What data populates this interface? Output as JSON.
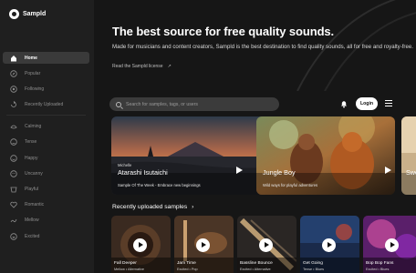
{
  "app": {
    "name": "Sampld"
  },
  "sidebar": {
    "primary": [
      {
        "label": "Home",
        "icon": "home-icon",
        "active": true
      },
      {
        "label": "Popular",
        "icon": "compass-icon"
      },
      {
        "label": "Following",
        "icon": "following-icon"
      },
      {
        "label": "Recently Uploaded",
        "icon": "upload-icon"
      }
    ],
    "genres": [
      {
        "label": "Calming",
        "icon": "calming-icon"
      },
      {
        "label": "Tense",
        "icon": "tense-icon"
      },
      {
        "label": "Happy",
        "icon": "happy-icon"
      },
      {
        "label": "Uncanny",
        "icon": "uncanny-icon"
      },
      {
        "label": "Playful",
        "icon": "playful-icon"
      },
      {
        "label": "Romantic",
        "icon": "romantic-icon"
      },
      {
        "label": "Mellow",
        "icon": "mellow-icon"
      },
      {
        "label": "Excited",
        "icon": "excited-icon"
      }
    ]
  },
  "hero": {
    "title": "The best source for free quality sounds.",
    "description": "Made for musicians and content creators, Sampld is the best destination to find quality sounds, all for free and royalty-free.",
    "license_link": "Read the Sampld license",
    "license_arrow": "↗"
  },
  "search": {
    "placeholder": "Search for samples, tags, or users"
  },
  "header": {
    "login_label": "Login"
  },
  "featured": [
    {
      "category": "Michelle",
      "title": "Atarashi Isutaichi",
      "caption": "Sample Of The Week - Embrace new beginnings"
    },
    {
      "category": "",
      "title": "Jungle Boy",
      "caption": "Wild ways for playful adventures"
    },
    {
      "category": "",
      "title": "Swe",
      "caption": ""
    }
  ],
  "recent": {
    "title": "Recently uploaded samples",
    "arrow": "›",
    "items": [
      {
        "title": "Fall Deeper",
        "tags": "Mellow • Alternative"
      },
      {
        "title": "Jam Time",
        "tags": "Excited • Pop"
      },
      {
        "title": "Bassline Bounce",
        "tags": "Excited • Alternative"
      },
      {
        "title": "Get Going",
        "tags": "Tense • Blues"
      },
      {
        "title": "Bop Bop Fans",
        "tags": "Excited • Blues"
      }
    ]
  },
  "colors": {
    "background": "#161616",
    "sidebar": "#1f1f1f",
    "active": "#3a3a3a",
    "accent": "#ffffff"
  }
}
